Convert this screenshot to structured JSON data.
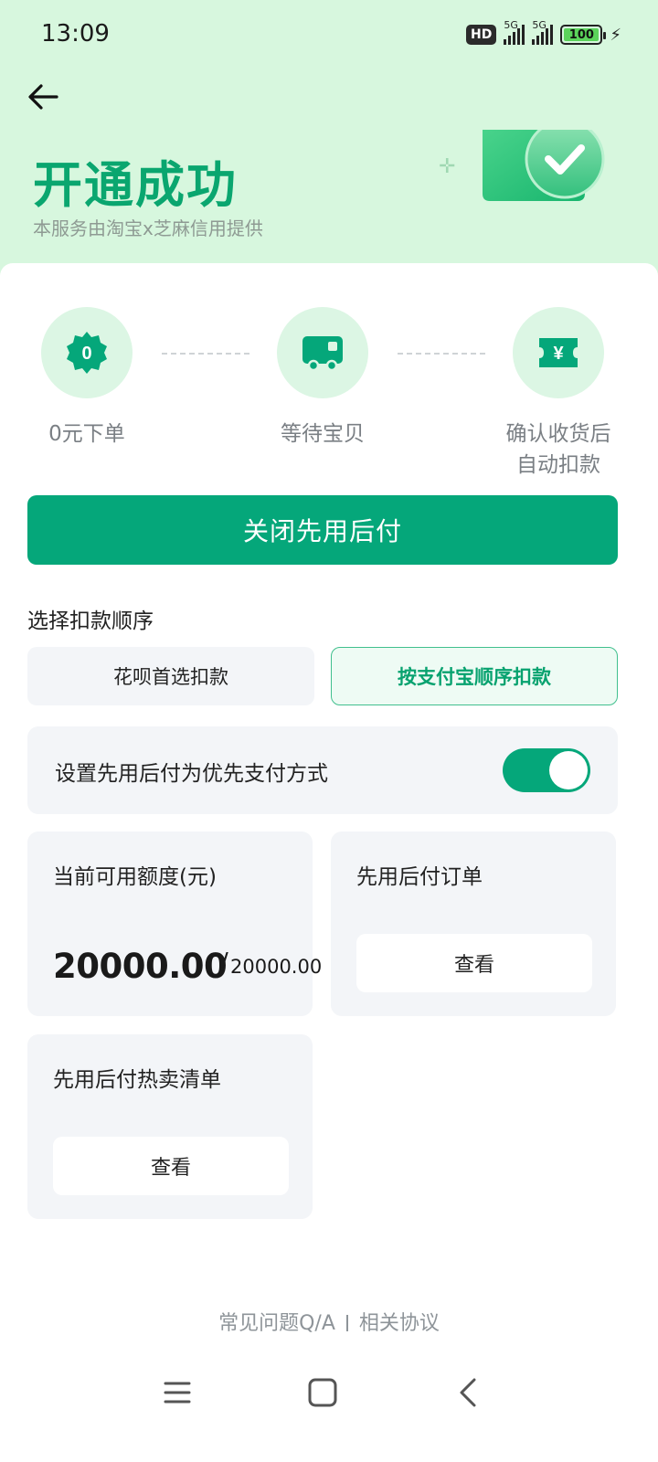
{
  "status_bar": {
    "time": "13:09",
    "hd_badge": "HD",
    "network_1": "5G",
    "network_2": "5G",
    "battery": "100"
  },
  "header": {
    "title": "开通成功",
    "subtitle": "本服务由淘宝x芝麻信用提供",
    "accent_color": "#0aa66f",
    "background_color": "#d7f7de"
  },
  "steps": [
    {
      "icon": "zero-badge-icon",
      "badge_text": "0",
      "label": "0元下单"
    },
    {
      "icon": "truck-icon",
      "label": "等待宝贝"
    },
    {
      "icon": "yuan-ticket-icon",
      "badge_text": "¥",
      "label_line1": "确认收货后",
      "label_line2": "自动扣款"
    }
  ],
  "close_button": {
    "label": "关闭先用后付",
    "color": "#05a77a"
  },
  "deduction_order": {
    "title": "选择扣款顺序",
    "options": [
      {
        "label": "花呗首选扣款",
        "selected": false
      },
      {
        "label": "按支付宝顺序扣款",
        "selected": true
      }
    ]
  },
  "preferred_payment": {
    "label": "设置先用后付为优先支付方式",
    "enabled": true
  },
  "quota_card": {
    "title": "当前可用额度(元)",
    "available": "20000.00",
    "slash": "/",
    "total": "20000.00"
  },
  "orders_card": {
    "title": "先用后付订单",
    "button": "查看"
  },
  "hot_list_card": {
    "title": "先用后付热卖清单",
    "button": "查看"
  },
  "footer": {
    "faq": "常见问题Q/A",
    "agreement": "相关协议"
  },
  "nav_bar": {
    "items": [
      "menu-icon",
      "home-square-icon",
      "back-chevron-icon"
    ]
  }
}
